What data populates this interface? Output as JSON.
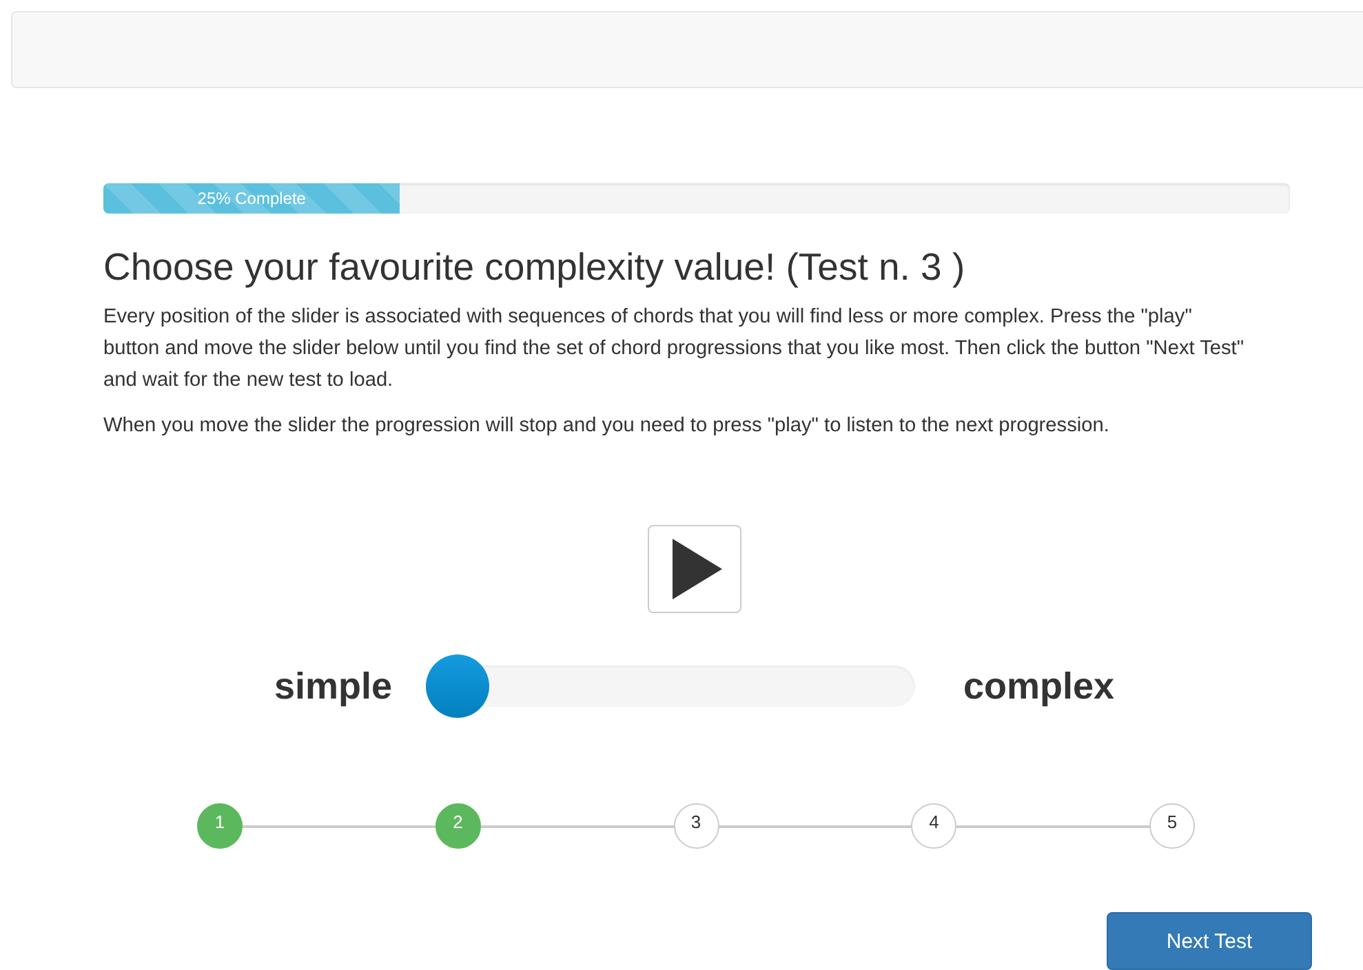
{
  "progress": {
    "label": "25% Complete",
    "level": 0.25
  },
  "title": "Choose your favourite complexity value! (Test n. 3 )",
  "paragraphs": [
    "Every position of the slider is associated with sequences of chords that you will find less or more complex. Press the \"play\" button and move the slider below until you find the set of chord progressions that you like most. Then click the button \"Next Test\" and wait for the new test to load.",
    "When you move the slider the progression will stop and you need to press \"play\" to listen to the next progression."
  ],
  "slider": {
    "min_label": "simple",
    "max_label": "complex",
    "level": 0
  },
  "steps": [
    {
      "label": "1",
      "completed": true
    },
    {
      "label": "2",
      "completed": true
    },
    {
      "label": "3",
      "completed": false
    },
    {
      "label": "4",
      "completed": false
    },
    {
      "label": "5",
      "completed": false
    }
  ],
  "next_button": "Next Test"
}
